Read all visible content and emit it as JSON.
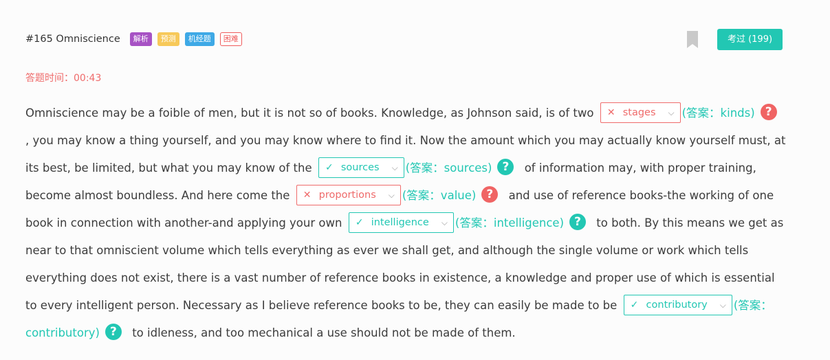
{
  "header": {
    "title": "#165 Omniscience",
    "tags": [
      {
        "label": "解析",
        "color": "#a752c4"
      },
      {
        "label": "预测",
        "color": "#f7c95a"
      },
      {
        "label": "机经题",
        "color": "#3ea9e6"
      },
      {
        "label": "困难",
        "color": "#ef5b5b"
      }
    ],
    "taken_button": "考过 (199)"
  },
  "timer": "答题时间：00:43",
  "passage": {
    "seg1": "Omniscience may be a foible of men, but it is not so of books. Knowledge, as Johnson said, is of two",
    "blank1": {
      "mark": "✕",
      "value": "stages",
      "answer": "(答案：kinds)",
      "status": "wrong"
    },
    "seg2": ", you may know a thing yourself, and you may know where to find it. Now the amount which you may actually know yourself must, at its best, be limited, but what you may know of the",
    "blank2": {
      "mark": "✓",
      "value": "sources",
      "answer": "(答案：sources)",
      "status": "correct"
    },
    "seg3": "of information may, with proper training, become almost boundless. And here come the",
    "blank3": {
      "mark": "✕",
      "value": "proportions",
      "answer": "(答案：value)",
      "status": "wrong"
    },
    "seg4": "and use of reference books-the working of one book in connection with another-and applying your own",
    "blank4": {
      "mark": "✓",
      "value": "intelligence",
      "answer": "(答案：intelligence)",
      "status": "correct"
    },
    "seg5": "to both. By this means we get as near to that omniscient volume which tells everything as ever we shall get, and although the single volume or work which tells everything does not exist, there is a vast number of reference books in existence, a knowledge and proper use of which is essential to every intelligent person. Necessary as I believe reference books to be, they can easily be made to be",
    "blank5": {
      "mark": "✓",
      "value": "contributory",
      "answer": "(答案：contributory)",
      "status": "correct"
    },
    "seg6": "to idleness, and too mechanical a use should not be made of them."
  },
  "icons": {
    "chevron": "⌵",
    "help": "?",
    "bookmark": "bookmark-icon"
  },
  "colors": {
    "accent": "#22c7b3",
    "error": "#ef6b6b"
  }
}
